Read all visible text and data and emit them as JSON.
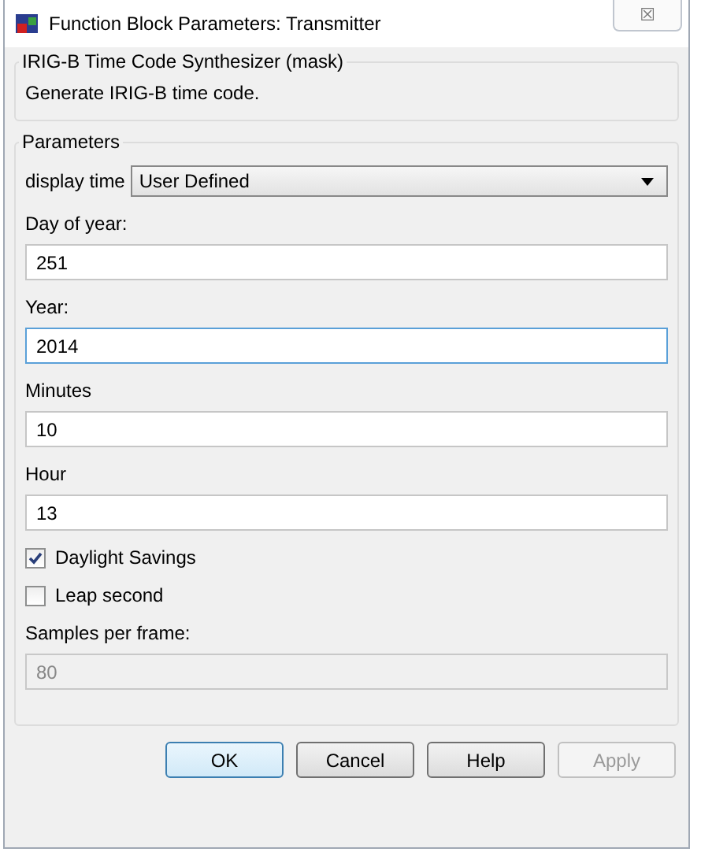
{
  "window": {
    "title": "Function Block Parameters: Transmitter",
    "close": "☒"
  },
  "mask": {
    "title": "IRIG-B Time Code Synthesizer (mask)",
    "description": "Generate IRIG-B time code."
  },
  "parameters": {
    "title": "Parameters",
    "items": [
      {
        "kind": "dropdown",
        "label": "display time",
        "value": "User Defined"
      },
      {
        "kind": "text",
        "label": "Day of year:",
        "value": "251",
        "focused": false,
        "disabled": false
      },
      {
        "kind": "text",
        "label": "Year:",
        "value": "2014",
        "focused": true,
        "disabled": false
      },
      {
        "kind": "text",
        "label": "Minutes",
        "value": "10",
        "focused": false,
        "disabled": false
      },
      {
        "kind": "text",
        "label": "Hour",
        "value": "13",
        "focused": false,
        "disabled": false
      },
      {
        "kind": "checkbox",
        "label": "Daylight Savings",
        "checked": true
      },
      {
        "kind": "checkbox",
        "label": "Leap second",
        "checked": false
      },
      {
        "kind": "text",
        "label": "Samples per frame:",
        "value": "80",
        "focused": false,
        "disabled": true
      }
    ]
  },
  "buttons": [
    {
      "label": "OK",
      "default": true,
      "disabled": false
    },
    {
      "label": "Cancel",
      "default": false,
      "disabled": false
    },
    {
      "label": "Help",
      "default": false,
      "disabled": false
    },
    {
      "label": "Apply",
      "default": false,
      "disabled": true
    }
  ]
}
